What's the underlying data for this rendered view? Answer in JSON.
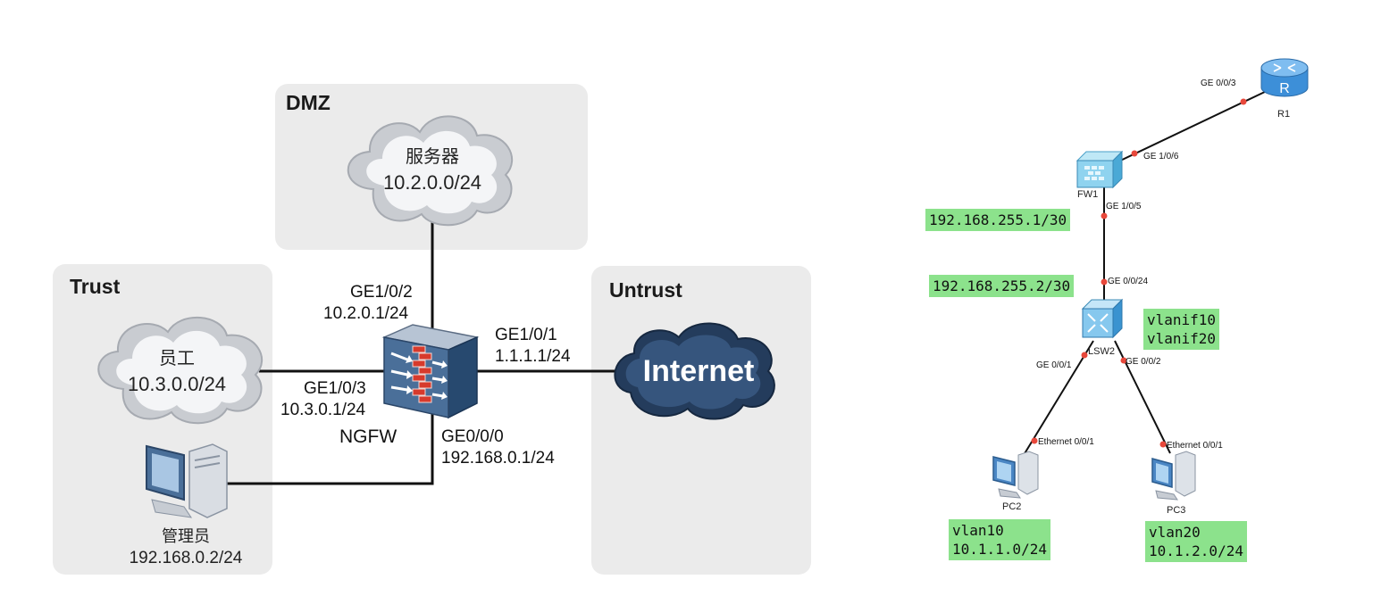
{
  "left_diagram": {
    "zones": {
      "dmz": "DMZ",
      "trust": "Trust",
      "untrust": "Untrust"
    },
    "server_cloud": {
      "name": "服务器",
      "subnet": "10.2.0.0/24"
    },
    "staff_cloud": {
      "name": "员工",
      "subnet": "10.3.0.0/24"
    },
    "internet_cloud": "Internet",
    "admin_pc": {
      "name": "管理员",
      "ip": "192.168.0.2/24"
    },
    "firewall": "NGFW",
    "interfaces": {
      "ge102": {
        "port": "GE1/0/2",
        "ip": "10.2.0.1/24"
      },
      "ge101": {
        "port": "GE1/0/1",
        "ip": "1.1.1.1/24"
      },
      "ge103": {
        "port": "GE1/0/3",
        "ip": "10.3.0.1/24"
      },
      "ge000": {
        "port": "GE0/0/0",
        "ip": "192.168.0.1/24"
      }
    }
  },
  "right_diagram": {
    "devices": {
      "r1": "R1",
      "fw1": "FW1",
      "lsw2": "LSW2",
      "pc2": "PC2",
      "pc3": "PC3"
    },
    "ports": {
      "r1_ge003": "GE 0/0/3",
      "fw_ge106": "GE 1/0/6",
      "fw_ge105": "GE 1/0/5",
      "sw_ge0024": "GE 0/0/24",
      "sw_ge001": "GE 0/0/1",
      "sw_ge002": "GE 0/0/2",
      "pc2_eth": "Ethernet 0/0/1",
      "pc3_eth": "Ethernet 0/0/1"
    },
    "notes": {
      "fw_ip": "192.168.255.1/30",
      "sw_ip": "192.168.255.2/30",
      "vlanif": [
        "vlanif10",
        "vlanif20"
      ],
      "pc2_net": [
        "vlan10",
        "10.1.1.0/24"
      ],
      "pc3_net": [
        "vlan20",
        "10.1.2.0/24"
      ]
    },
    "colors": {
      "note_bg": "#8ce28c",
      "port_dot": "#e8483b"
    }
  }
}
